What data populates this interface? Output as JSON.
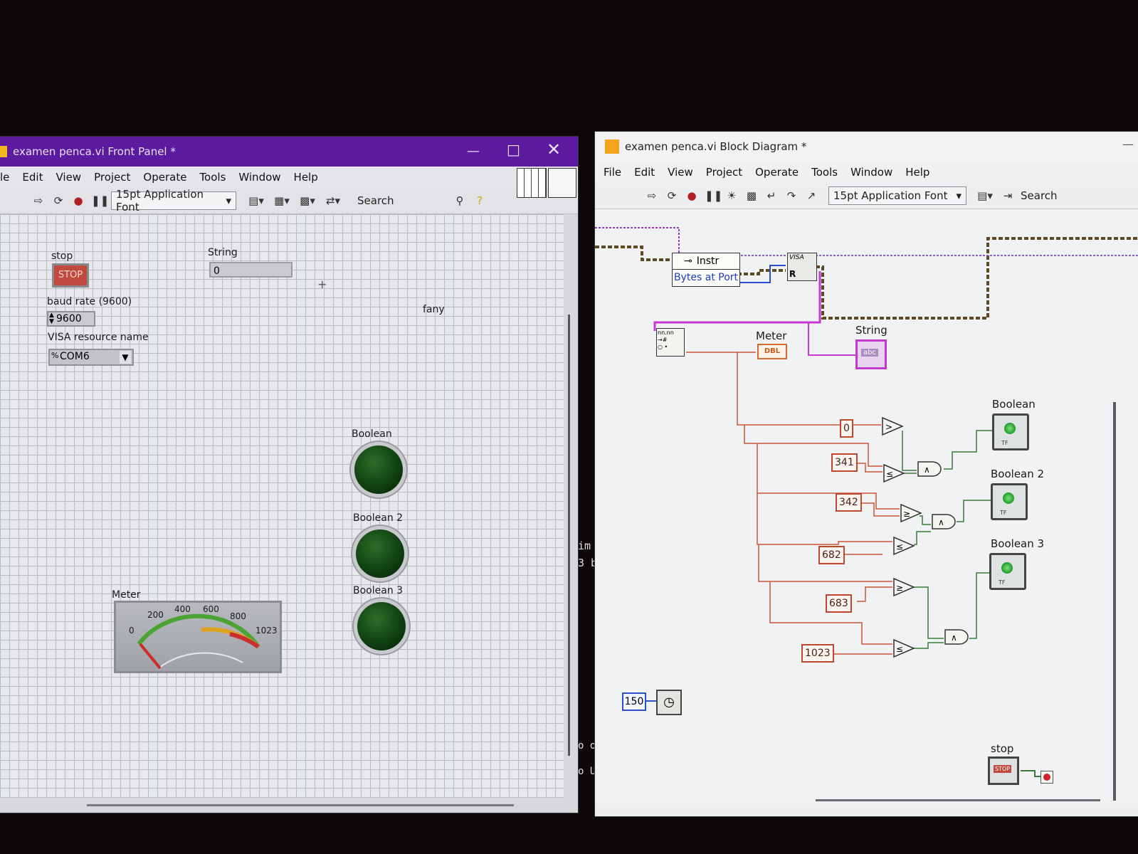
{
  "front_panel": {
    "title": "examen penca.vi Front Panel *",
    "menu": [
      "le",
      "Edit",
      "View",
      "Project",
      "Operate",
      "Tools",
      "Window",
      "Help"
    ],
    "font_select": "15pt Application Font",
    "search_label": "Search",
    "controls": {
      "stop": {
        "label": "stop",
        "button_text": "STOP"
      },
      "string": {
        "label": "String",
        "value": "0"
      },
      "baud": {
        "label": "baud rate (9600)",
        "value": "9600"
      },
      "visa": {
        "label": "VISA resource name",
        "value": "COM6"
      },
      "free_label": "fany",
      "booleans": [
        "Boolean",
        "Boolean 2",
        "Boolean 3"
      ],
      "meter": {
        "label": "Meter",
        "scale": [
          "0",
          "200",
          "400",
          "600",
          "800",
          "1023"
        ],
        "value": 0
      }
    },
    "background_text": [
      "im",
      "3 b",
      "o or",
      "o U"
    ]
  },
  "block_diagram": {
    "title": "examen penca.vi Block Diagram *",
    "menu": [
      "File",
      "Edit",
      "View",
      "Project",
      "Operate",
      "Tools",
      "Window",
      "Help"
    ],
    "font_select": "15pt Application Font",
    "search_label": "Search",
    "nodes": {
      "property_class": "Instr",
      "property_name": "Bytes at Port",
      "visa_read": "VISA",
      "meter_label": "Meter",
      "meter_terminal": "DBL",
      "string_label": "String",
      "string_terminal": "abc",
      "stop_label": "stop",
      "stop_terminal": "STOP",
      "wait_constant": "150"
    },
    "constants": [
      "0",
      "341",
      "342",
      "682",
      "683",
      "1023"
    ],
    "indicators": [
      "Boolean",
      "Boolean 2",
      "Boolean 3"
    ],
    "tf_text": "TF"
  },
  "colors": {
    "fp_titlebar": "#5c1a9e",
    "numeric_wire": "#c0472b",
    "string_wire": "#b12fd0",
    "visa_wire": "#6d4a20",
    "bool_wire": "#3b7a3a"
  }
}
